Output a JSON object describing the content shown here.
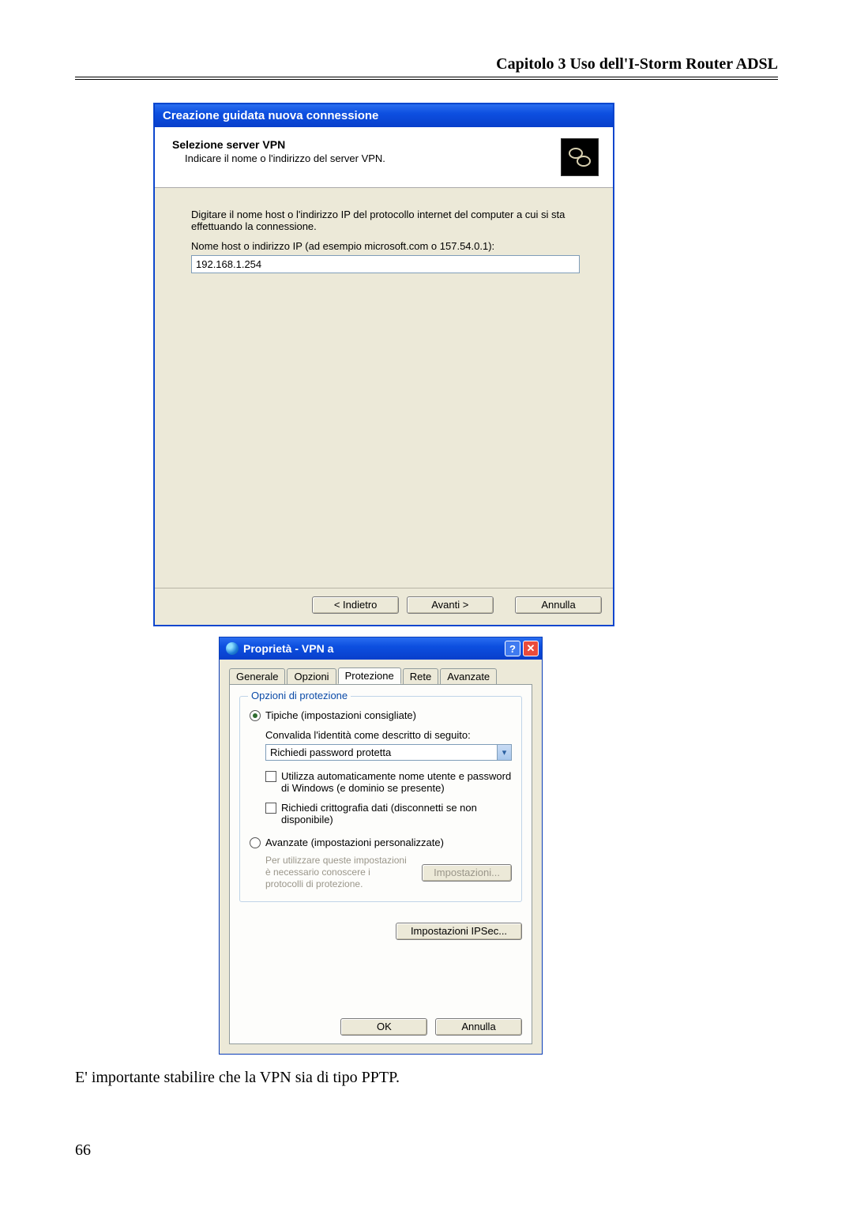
{
  "doc": {
    "header": "Capitolo  3  Uso dell'I-Storm Router ADSL",
    "caption": "E' importante stabilire che la VPN sia di tipo PPTP.",
    "page_number": "66"
  },
  "wizard": {
    "title": "Creazione guidata nuova connessione",
    "heading": "Selezione server VPN",
    "sub": "Indicare il nome o l'indirizzo del server VPN.",
    "body1": "Digitare il nome host o l'indirizzo IP del protocollo internet del computer a cui si sta effettuando la connessione.",
    "body2": "Nome host o indirizzo IP (ad esempio microsoft.com o 157.54.0.1):",
    "input_value": "192.168.1.254",
    "btn_back": "< Indietro",
    "btn_next": "Avanti >",
    "btn_cancel": "Annulla"
  },
  "props": {
    "title": "Proprietà - VPN a",
    "tabs": {
      "generale": "Generale",
      "opzioni": "Opzioni",
      "protezione": "Protezione",
      "rete": "Rete",
      "avanzate": "Avanzate"
    },
    "group_title": "Opzioni di protezione",
    "radio_typical": "Tipiche (impostazioni consigliate)",
    "validate_label": "Convalida l'identità come descritto di seguito:",
    "combo_value": "Richiedi password protetta",
    "check_auto": "Utilizza automaticamente nome utente e password di Windows (e dominio se presente)",
    "check_encrypt": "Richiedi crittografia dati (disconnetti se non disponibile)",
    "radio_advanced": "Avanzate (impostazioni personalizzate)",
    "adv_note": "Per utilizzare queste impostazioni è necessario conoscere i protocolli di protezione.",
    "btn_settings": "Impostazioni...",
    "btn_ipsec": "Impostazioni IPSec...",
    "btn_ok": "OK",
    "btn_cancel": "Annulla"
  }
}
